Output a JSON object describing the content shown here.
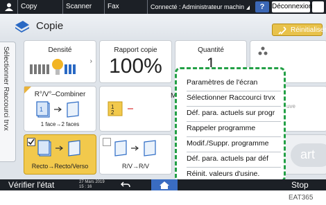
{
  "topbar": {
    "tabs": [
      "Copy",
      "Scanner",
      "Fax"
    ],
    "status": "Connecté : Administrateur machine",
    "help_label": "?",
    "disconnect_label": "Déconnexion"
  },
  "header": {
    "title": "Copie",
    "reset_label": "Réinitialiser"
  },
  "sidetab": {
    "label": "Sélectionner Raccourci trvx"
  },
  "cards": {
    "density": {
      "label": "Densité",
      "level_fraction": 0.5
    },
    "ratio": {
      "label": "Rapport copie",
      "value": "100%"
    },
    "quantity": {
      "label": "Quantité",
      "value": "1"
    },
    "combine": {
      "label": "R°/V°–Combiner",
      "sublabel": "1 face→2 faces"
    },
    "partial_label": "M",
    "partial_right": "uve",
    "duplex1": {
      "label": "Recto→Recto/Verso"
    },
    "duplex2": {
      "label": "R/V→R/V"
    },
    "start_partial": "art"
  },
  "menu": {
    "items": [
      "Paramètres de l'écran",
      "Sélectionner Raccourci trvx",
      "Déf. para. actuels sur progr",
      "Rappeler programme",
      "Modif./Suppr. programme",
      "Déf. para. actuels par déf",
      "Réinit. valeurs d'usine."
    ]
  },
  "bottombar": {
    "check_status": "Vérifier l'état",
    "date": "27 Mars 2019",
    "time": "15 : 16",
    "stop_label": "Stop"
  },
  "figure_id": "EAT365",
  "colors": {
    "accent_green": "#23a046",
    "accent_yellow": "#f2c94c",
    "home_blue": "#3a6cc2"
  }
}
